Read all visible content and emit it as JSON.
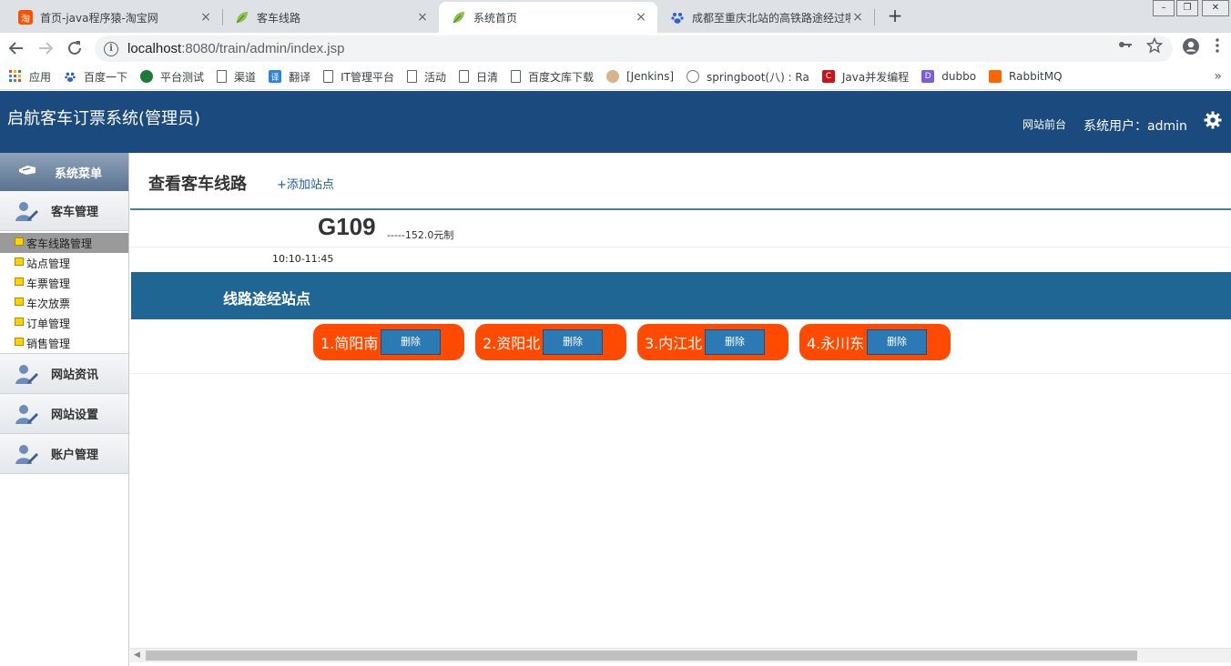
{
  "browser": {
    "tabs": [
      {
        "title": "首页-java程序猿-淘宝网",
        "icon": "taobao-icon",
        "icon_glyph": "淘"
      },
      {
        "title": "客车线路",
        "icon": "leaf-icon"
      },
      {
        "title": "系统首页",
        "icon": "leaf-icon"
      },
      {
        "title": "成都至重庆北站的高铁路途经过哪",
        "icon": "baidu-paw-icon"
      }
    ],
    "close_glyph": "×",
    "new_tab_glyph": "+",
    "url_host": "localhost",
    "url_rest": ":8080/train/admin/index.jsp",
    "bookmarks": [
      {
        "label": "应用",
        "icon": "apps-grid-icon"
      },
      {
        "label": "百度一下",
        "icon": "baidu-paw-icon"
      },
      {
        "label": "平台测试",
        "icon": "green-globe-icon"
      },
      {
        "label": "渠道",
        "icon": "document-icon"
      },
      {
        "label": "翻译",
        "icon": "translate-icon"
      },
      {
        "label": "IT管理平台",
        "icon": "document-icon"
      },
      {
        "label": "活动",
        "icon": "document-icon"
      },
      {
        "label": "日清",
        "icon": "document-icon"
      },
      {
        "label": "百度文库下载",
        "icon": "document-icon"
      },
      {
        "label": "[Jenkins]",
        "icon": "jenkins-icon"
      },
      {
        "label": "springboot(八) : Ra",
        "icon": "globe-icon"
      },
      {
        "label": "Java并发编程",
        "icon": "csdn-icon"
      },
      {
        "label": "dubbo",
        "icon": "dubbo-icon"
      },
      {
        "label": "RabbitMQ",
        "icon": "rabbitmq-icon"
      }
    ],
    "bookmarks_more": "»"
  },
  "header": {
    "title": "启航客车订票系统(管理员)",
    "front_link": "网站前台",
    "user_label": "系统用户：admin"
  },
  "sidebar": {
    "menu_title": "系统菜单",
    "groups": [
      {
        "label": "客车管理"
      },
      {
        "label": "网站资讯"
      },
      {
        "label": "网站设置"
      },
      {
        "label": "账户管理"
      }
    ],
    "subitems": [
      {
        "label": "客车线路管理",
        "active": true
      },
      {
        "label": "站点管理"
      },
      {
        "label": "车票管理"
      },
      {
        "label": "车次放票"
      },
      {
        "label": "订单管理"
      },
      {
        "label": "销售管理"
      }
    ]
  },
  "main": {
    "page_title": "查看客车线路",
    "add_link": "+添加站点",
    "train_no": "G109",
    "price": "-----152.0元制",
    "time_range": "10:10-11:45",
    "section_title": "线路途经站点",
    "stops": [
      {
        "name": "1.简阳南",
        "delete_label": "删除"
      },
      {
        "name": "2.资阳北",
        "delete_label": "删除"
      },
      {
        "name": "3.内江北",
        "delete_label": "删除"
      },
      {
        "name": "4.永川东",
        "delete_label": "删除"
      }
    ]
  },
  "colors": {
    "header_bg": "#1b4a7e",
    "section_bar": "#1f6694",
    "stop_bg": "#ff4a00",
    "delete_btn": "#2b79b5"
  }
}
